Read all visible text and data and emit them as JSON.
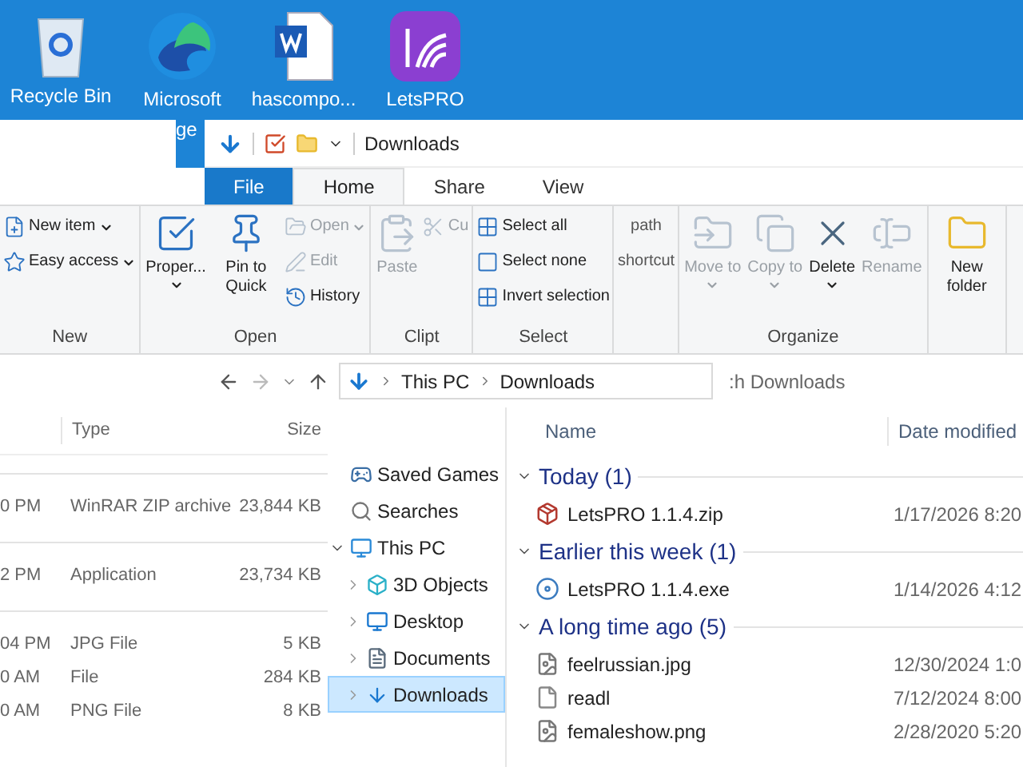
{
  "desktop_icons": [
    {
      "label": "Recycle Bin",
      "kind": "recycle"
    },
    {
      "label": "Microsoft",
      "kind": "browser"
    },
    {
      "label": "hascompo...",
      "kind": "document"
    },
    {
      "label": "LetsPRO",
      "kind": "app"
    }
  ],
  "desktop_fragment": "ge",
  "window": {
    "title": "Downloads"
  },
  "tabs": [
    {
      "label": "File",
      "kind": "file",
      "selected": false
    },
    {
      "label": "Home",
      "kind": "tab",
      "selected": true
    },
    {
      "label": "Share",
      "kind": "tab",
      "selected": false
    },
    {
      "label": "View",
      "kind": "tab",
      "selected": false
    }
  ],
  "ribbon": [
    {
      "label": "New",
      "items": [
        {
          "label": "New item",
          "kind": "small",
          "caret": true,
          "disabled": false
        },
        {
          "label": "Easy access",
          "kind": "small",
          "caret": true,
          "disabled": false
        }
      ]
    },
    {
      "label": "Open",
      "items": [
        {
          "label": "Proper...",
          "kind": "large",
          "caret": true,
          "disabled": false
        },
        {
          "label": "Pin to Quick",
          "kind": "large",
          "caret": false,
          "disabled": false
        },
        {
          "label": "Open",
          "kind": "small",
          "caret": true,
          "disabled": true
        },
        {
          "label": "Edit",
          "kind": "small",
          "caret": false,
          "disabled": true
        },
        {
          "label": "History",
          "kind": "small",
          "caret": false,
          "disabled": false
        }
      ]
    },
    {
      "label": "Clipt",
      "items": [
        {
          "label": "Paste",
          "kind": "large",
          "caret": false,
          "disabled": true
        },
        {
          "label": "Cu",
          "kind": "small",
          "caret": false,
          "disabled": true
        }
      ]
    },
    {
      "label": "Select",
      "items": [
        {
          "label": "Select all",
          "kind": "small",
          "caret": false,
          "disabled": false
        },
        {
          "label": "Select none",
          "kind": "small",
          "caret": false,
          "disabled": false
        },
        {
          "label": "Invert selection",
          "kind": "small",
          "caret": false,
          "disabled": false
        }
      ]
    },
    {
      "items": [
        {
          "label": "path",
          "kind": "text",
          "disabled": false
        },
        {
          "label": "shortcut",
          "kind": "text",
          "disabled": false
        }
      ]
    },
    {
      "label": "Organize",
      "items": [
        {
          "label": "Move to",
          "kind": "large",
          "caret": true,
          "disabled": true
        },
        {
          "label": "Copy to",
          "kind": "large",
          "caret": true,
          "disabled": true
        },
        {
          "label": "Delete",
          "kind": "large",
          "caret": true,
          "disabled": false
        },
        {
          "label": "Rename",
          "kind": "large",
          "caret": false,
          "disabled": true
        }
      ]
    },
    {
      "items": [
        {
          "label": "New folder",
          "kind": "large",
          "disabled": false
        }
      ]
    }
  ],
  "address": {
    "crumbs": [
      "This PC",
      "Downloads"
    ],
    "search_placeholder": ":h Downloads"
  },
  "back_list": {
    "columns": [
      "",
      "Type",
      "Size"
    ],
    "groups": [
      {
        "rows": [
          [
            "0 PM",
            "WinRAR ZIP archive",
            "23,844 KB"
          ]
        ]
      },
      {
        "rows": [
          [
            "2 PM",
            "Application",
            "23,734 KB"
          ]
        ]
      },
      {
        "rows": [
          [
            "04 PM",
            "JPG File",
            "5 KB"
          ],
          [
            "0 AM",
            "File",
            "284 KB"
          ],
          [
            "0 AM",
            "PNG File",
            "8 KB"
          ]
        ]
      }
    ]
  },
  "nav_tree": [
    {
      "label": "Saved Games",
      "kind": "games",
      "selected": false
    },
    {
      "label": "Searches",
      "kind": "search",
      "selected": false
    },
    {
      "label": "This PC",
      "kind": "pc",
      "selected": false,
      "expanded": true,
      "children": [
        {
          "label": "3D Objects",
          "kind": "cube",
          "selected": false,
          "expanded": false
        },
        {
          "label": "Desktop",
          "kind": "desktop",
          "selected": false,
          "expanded": false
        },
        {
          "label": "Documents",
          "kind": "docs",
          "selected": false,
          "expanded": false
        },
        {
          "label": "Downloads",
          "kind": "download",
          "selected": true,
          "expanded": false
        }
      ]
    }
  ],
  "file_list": {
    "columns": [
      "Name",
      "Date modified"
    ],
    "groups": [
      {
        "label": "Today (1)",
        "expanded": true,
        "files": [
          {
            "name": "LetsPRO 1.1.4.zip",
            "kind": "archive",
            "date": "1/17/2026 8:20"
          }
        ]
      },
      {
        "label": "Earlier this week (1)",
        "expanded": true,
        "files": [
          {
            "name": "LetsPRO 1.1.4.exe",
            "kind": "installer",
            "date": "1/14/2026 4:12"
          }
        ]
      },
      {
        "label": "A long time ago (5)",
        "expanded": true,
        "files": [
          {
            "name": "feelrussian.jpg",
            "kind": "image",
            "date": "12/30/2024 1:0"
          },
          {
            "name": "readl",
            "kind": "file",
            "date": "7/12/2024 8:00"
          },
          {
            "name": "femaleshow.png",
            "kind": "image",
            "date": "2/28/2020 5:20"
          }
        ]
      }
    ]
  }
}
